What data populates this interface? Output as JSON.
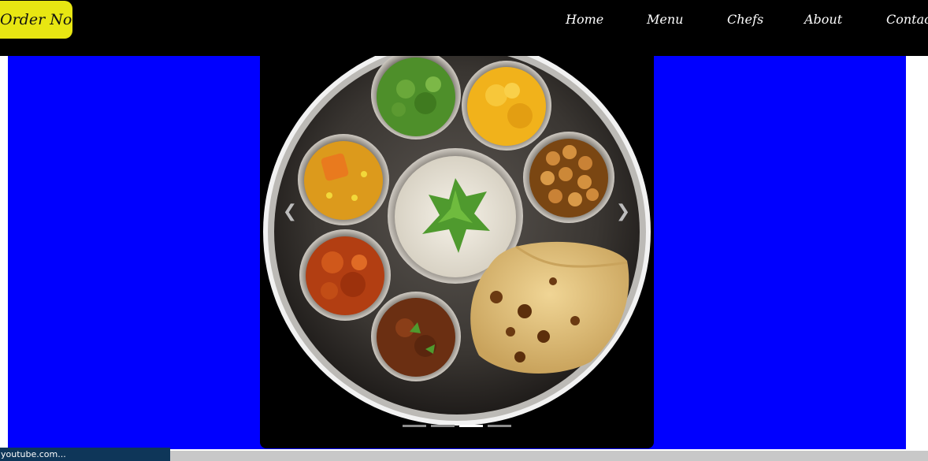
{
  "header": {
    "order_button": "Order Now",
    "nav": [
      "Home",
      "Menu",
      "Chefs",
      "About",
      "Contact"
    ]
  },
  "carousel": {
    "prev_glyph": "❮",
    "next_glyph": "❯",
    "slide_count": 4,
    "active_slide": 3
  },
  "status_bar": {
    "text": "youtube.com..."
  },
  "colors": {
    "navbar": "#000000",
    "order_button": "#e8e612",
    "hero_background": "#0000ff",
    "status_bar": "#0e3659"
  }
}
